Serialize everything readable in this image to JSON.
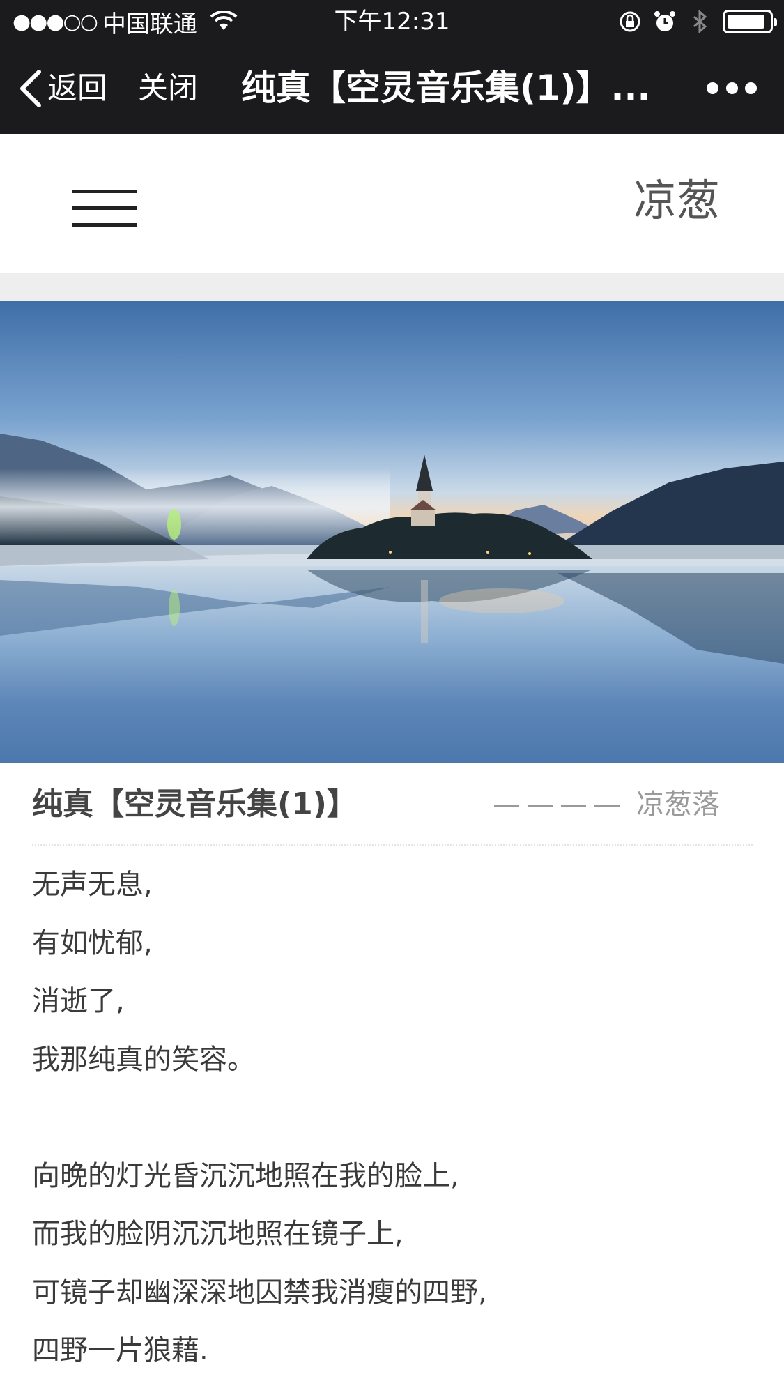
{
  "status_bar": {
    "signal": "●●●○○",
    "carrier": "中国联通",
    "time": "下午12:31"
  },
  "nav": {
    "back_label": "返回",
    "close_label": "关闭",
    "title": "纯真【空灵音乐集(1)】..."
  },
  "header": {
    "brand": "凉葱"
  },
  "hero": {
    "image_description_icon": "lake-castle-landscape"
  },
  "article": {
    "title": "纯真【空灵音乐集(1)】",
    "author_dashes": "————",
    "author": "凉葱落",
    "lines": [
      "无声无息,",
      "有如忧郁,",
      "消逝了,",
      "我那纯真的笑容。",
      "",
      "向晚的灯光昏沉沉地照在我的脸上,",
      "而我的脸阴沉沉地照在镜子上,",
      "可镜子却幽深深地囚禁我消瘦的四野,",
      "四野一片狼藉."
    ]
  },
  "colors": {
    "bar_bg": "#1b1b1d",
    "text": "#3a3a3a",
    "muted": "#9a9a9a",
    "strip": "#eeeeee"
  }
}
